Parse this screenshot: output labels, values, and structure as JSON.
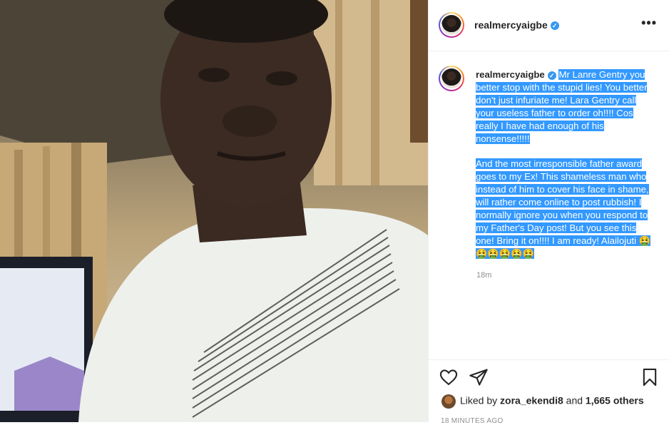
{
  "post": {
    "username": "realmercyaigbe",
    "verified_glyph": "✓",
    "more_glyph": "•••",
    "caption": {
      "paragraph1": "Mr Lanre Gentry you better stop with the stupid lies! You better don't just infuriate me! Lara Gentry call your useless father to order oh!!!! Cos really I have had enough of his nonsense!!!!!",
      "paragraph2": "And the most irresponsible father award goes to my Ex! This shameless man who instead of him to cover his face in shame, will rather come online to post rubbish! I normally ignore you when you respond to my Father's Day post! But you see this one! Bring it on!!!! I am ready! Alailojuti 🤮🤮🤮🤮🤮🤮"
    },
    "caption_age": "18m",
    "likes": {
      "prefix": "Liked by ",
      "user": "zora_ekendi8",
      "middle": " and ",
      "count": "1,665 others"
    },
    "posted_time": "18 MINUTES AGO"
  },
  "icons": {
    "like": "heart-icon",
    "share": "send-icon",
    "save": "bookmark-icon",
    "more": "more-options-icon"
  },
  "colors": {
    "selection": "#3399ff",
    "verified": "#3897f0",
    "muted": "#8e8e8e"
  }
}
